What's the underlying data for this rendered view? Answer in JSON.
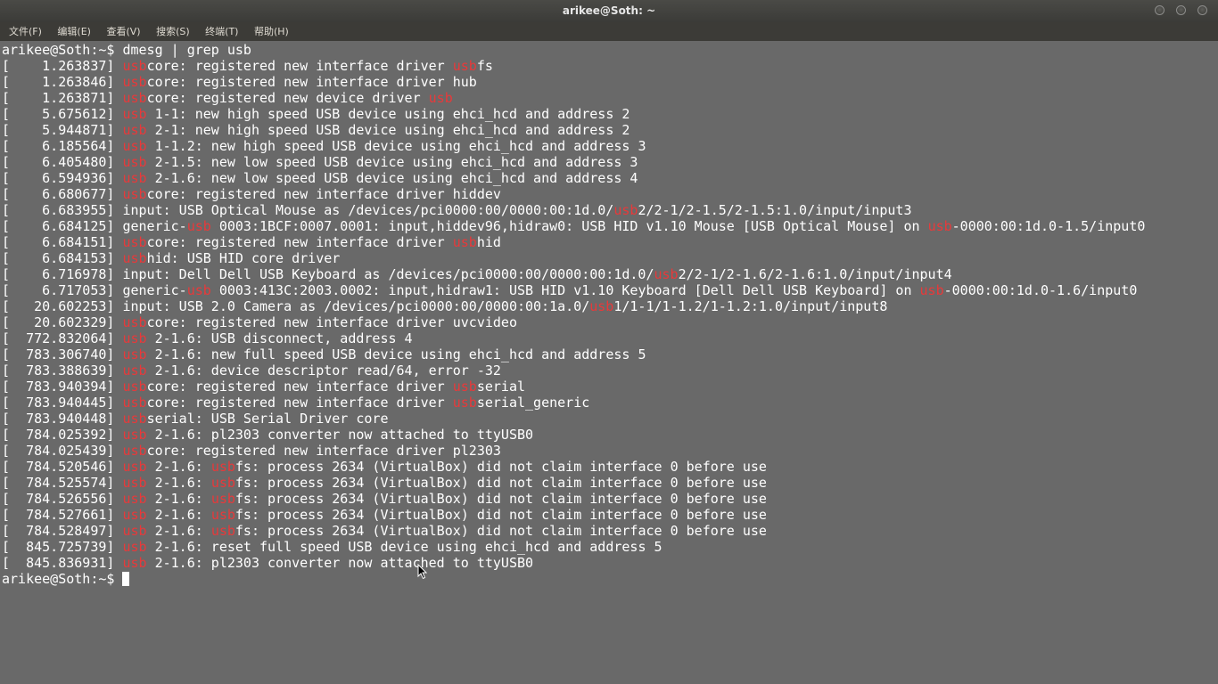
{
  "window": {
    "title": "arikee@Soth: ~",
    "controls": [
      "minimize-icon",
      "maximize-icon",
      "close-icon"
    ]
  },
  "menubar": {
    "items": [
      "文件(F)",
      "编辑(E)",
      "查看(V)",
      "搜索(S)",
      "终端(T)",
      "帮助(H)"
    ]
  },
  "terminal": {
    "highlight_color": "#e8393a",
    "text_color": "#ffffff",
    "background_color": "#696969",
    "lines": [
      [
        {
          "t": "arikee@Soth:~$ dmesg | grep usb"
        }
      ],
      [
        {
          "t": "[    1.263837] "
        },
        {
          "t": "usb",
          "h": true
        },
        {
          "t": "core: registered new interface driver "
        },
        {
          "t": "usb",
          "h": true
        },
        {
          "t": "fs"
        }
      ],
      [
        {
          "t": "[    1.263846] "
        },
        {
          "t": "usb",
          "h": true
        },
        {
          "t": "core: registered new interface driver hub"
        }
      ],
      [
        {
          "t": "[    1.263871] "
        },
        {
          "t": "usb",
          "h": true
        },
        {
          "t": "core: registered new device driver "
        },
        {
          "t": "usb",
          "h": true
        }
      ],
      [
        {
          "t": "[    5.675612] "
        },
        {
          "t": "usb",
          "h": true
        },
        {
          "t": " 1-1: new high speed USB device using ehci_hcd and address 2"
        }
      ],
      [
        {
          "t": "[    5.944871] "
        },
        {
          "t": "usb",
          "h": true
        },
        {
          "t": " 2-1: new high speed USB device using ehci_hcd and address 2"
        }
      ],
      [
        {
          "t": "[    6.185564] "
        },
        {
          "t": "usb",
          "h": true
        },
        {
          "t": " 1-1.2: new high speed USB device using ehci_hcd and address 3"
        }
      ],
      [
        {
          "t": "[    6.405480] "
        },
        {
          "t": "usb",
          "h": true
        },
        {
          "t": " 2-1.5: new low speed USB device using ehci_hcd and address 3"
        }
      ],
      [
        {
          "t": "[    6.594936] "
        },
        {
          "t": "usb",
          "h": true
        },
        {
          "t": " 2-1.6: new low speed USB device using ehci_hcd and address 4"
        }
      ],
      [
        {
          "t": "[    6.680677] "
        },
        {
          "t": "usb",
          "h": true
        },
        {
          "t": "core: registered new interface driver hiddev"
        }
      ],
      [
        {
          "t": "[    6.683955] input: USB Optical Mouse as /devices/pci0000:00/0000:00:1d.0/"
        },
        {
          "t": "usb",
          "h": true
        },
        {
          "t": "2/2-1/2-1.5/2-1.5:1.0/input/input3"
        }
      ],
      [
        {
          "t": "[    6.684125] generic-"
        },
        {
          "t": "usb",
          "h": true
        },
        {
          "t": " 0003:1BCF:0007.0001: input,hiddev96,hidraw0: USB HID v1.10 Mouse [USB Optical Mouse] on "
        },
        {
          "t": "usb",
          "h": true
        },
        {
          "t": "-0000:00:1d.0-1.5/input0"
        }
      ],
      [
        {
          "t": "[    6.684151] "
        },
        {
          "t": "usb",
          "h": true
        },
        {
          "t": "core: registered new interface driver "
        },
        {
          "t": "usb",
          "h": true
        },
        {
          "t": "hid"
        }
      ],
      [
        {
          "t": "[    6.684153] "
        },
        {
          "t": "usb",
          "h": true
        },
        {
          "t": "hid: USB HID core driver"
        }
      ],
      [
        {
          "t": "[    6.716978] input: Dell Dell USB Keyboard as /devices/pci0000:00/0000:00:1d.0/"
        },
        {
          "t": "usb",
          "h": true
        },
        {
          "t": "2/2-1/2-1.6/2-1.6:1.0/input/input4"
        }
      ],
      [
        {
          "t": "[    6.717053] generic-"
        },
        {
          "t": "usb",
          "h": true
        },
        {
          "t": " 0003:413C:2003.0002: input,hidraw1: USB HID v1.10 Keyboard [Dell Dell USB Keyboard] on "
        },
        {
          "t": "usb",
          "h": true
        },
        {
          "t": "-0000:00:1d.0-1.6/input0"
        }
      ],
      [
        {
          "t": "[   20.602253] input: USB 2.0 Camera as /devices/pci0000:00/0000:00:1a.0/"
        },
        {
          "t": "usb",
          "h": true
        },
        {
          "t": "1/1-1/1-1.2/1-1.2:1.0/input/input8"
        }
      ],
      [
        {
          "t": "[   20.602329] "
        },
        {
          "t": "usb",
          "h": true
        },
        {
          "t": "core: registered new interface driver uvcvideo"
        }
      ],
      [
        {
          "t": "[  772.832064] "
        },
        {
          "t": "usb",
          "h": true
        },
        {
          "t": " 2-1.6: USB disconnect, address 4"
        }
      ],
      [
        {
          "t": "[  783.306740] "
        },
        {
          "t": "usb",
          "h": true
        },
        {
          "t": " 2-1.6: new full speed USB device using ehci_hcd and address 5"
        }
      ],
      [
        {
          "t": "[  783.388639] "
        },
        {
          "t": "usb",
          "h": true
        },
        {
          "t": " 2-1.6: device descriptor read/64, error -32"
        }
      ],
      [
        {
          "t": "[  783.940394] "
        },
        {
          "t": "usb",
          "h": true
        },
        {
          "t": "core: registered new interface driver "
        },
        {
          "t": "usb",
          "h": true
        },
        {
          "t": "serial"
        }
      ],
      [
        {
          "t": "[  783.940445] "
        },
        {
          "t": "usb",
          "h": true
        },
        {
          "t": "core: registered new interface driver "
        },
        {
          "t": "usb",
          "h": true
        },
        {
          "t": "serial_generic"
        }
      ],
      [
        {
          "t": "[  783.940448] "
        },
        {
          "t": "usb",
          "h": true
        },
        {
          "t": "serial: USB Serial Driver core"
        }
      ],
      [
        {
          "t": "[  784.025392] "
        },
        {
          "t": "usb",
          "h": true
        },
        {
          "t": " 2-1.6: pl2303 converter now attached to ttyUSB0"
        }
      ],
      [
        {
          "t": "[  784.025439] "
        },
        {
          "t": "usb",
          "h": true
        },
        {
          "t": "core: registered new interface driver pl2303"
        }
      ],
      [
        {
          "t": "[  784.520546] "
        },
        {
          "t": "usb",
          "h": true
        },
        {
          "t": " 2-1.6: "
        },
        {
          "t": "usb",
          "h": true
        },
        {
          "t": "fs: process 2634 (VirtualBox) did not claim interface 0 before use"
        }
      ],
      [
        {
          "t": "[  784.525574] "
        },
        {
          "t": "usb",
          "h": true
        },
        {
          "t": " 2-1.6: "
        },
        {
          "t": "usb",
          "h": true
        },
        {
          "t": "fs: process 2634 (VirtualBox) did not claim interface 0 before use"
        }
      ],
      [
        {
          "t": "[  784.526556] "
        },
        {
          "t": "usb",
          "h": true
        },
        {
          "t": " 2-1.6: "
        },
        {
          "t": "usb",
          "h": true
        },
        {
          "t": "fs: process 2634 (VirtualBox) did not claim interface 0 before use"
        }
      ],
      [
        {
          "t": "[  784.527661] "
        },
        {
          "t": "usb",
          "h": true
        },
        {
          "t": " 2-1.6: "
        },
        {
          "t": "usb",
          "h": true
        },
        {
          "t": "fs: process 2634 (VirtualBox) did not claim interface 0 before use"
        }
      ],
      [
        {
          "t": "[  784.528497] "
        },
        {
          "t": "usb",
          "h": true
        },
        {
          "t": " 2-1.6: "
        },
        {
          "t": "usb",
          "h": true
        },
        {
          "t": "fs: process 2634 (VirtualBox) did not claim interface 0 before use"
        }
      ],
      [
        {
          "t": "[  845.725739] "
        },
        {
          "t": "usb",
          "h": true
        },
        {
          "t": " 2-1.6: reset full speed USB device using ehci_hcd and address 5"
        }
      ],
      [
        {
          "t": "[  845.836931] "
        },
        {
          "t": "usb",
          "h": true
        },
        {
          "t": " 2-1.6: pl2303 converter now attached to ttyUSB0"
        }
      ]
    ],
    "prompt": "arikee@Soth:~$ "
  }
}
